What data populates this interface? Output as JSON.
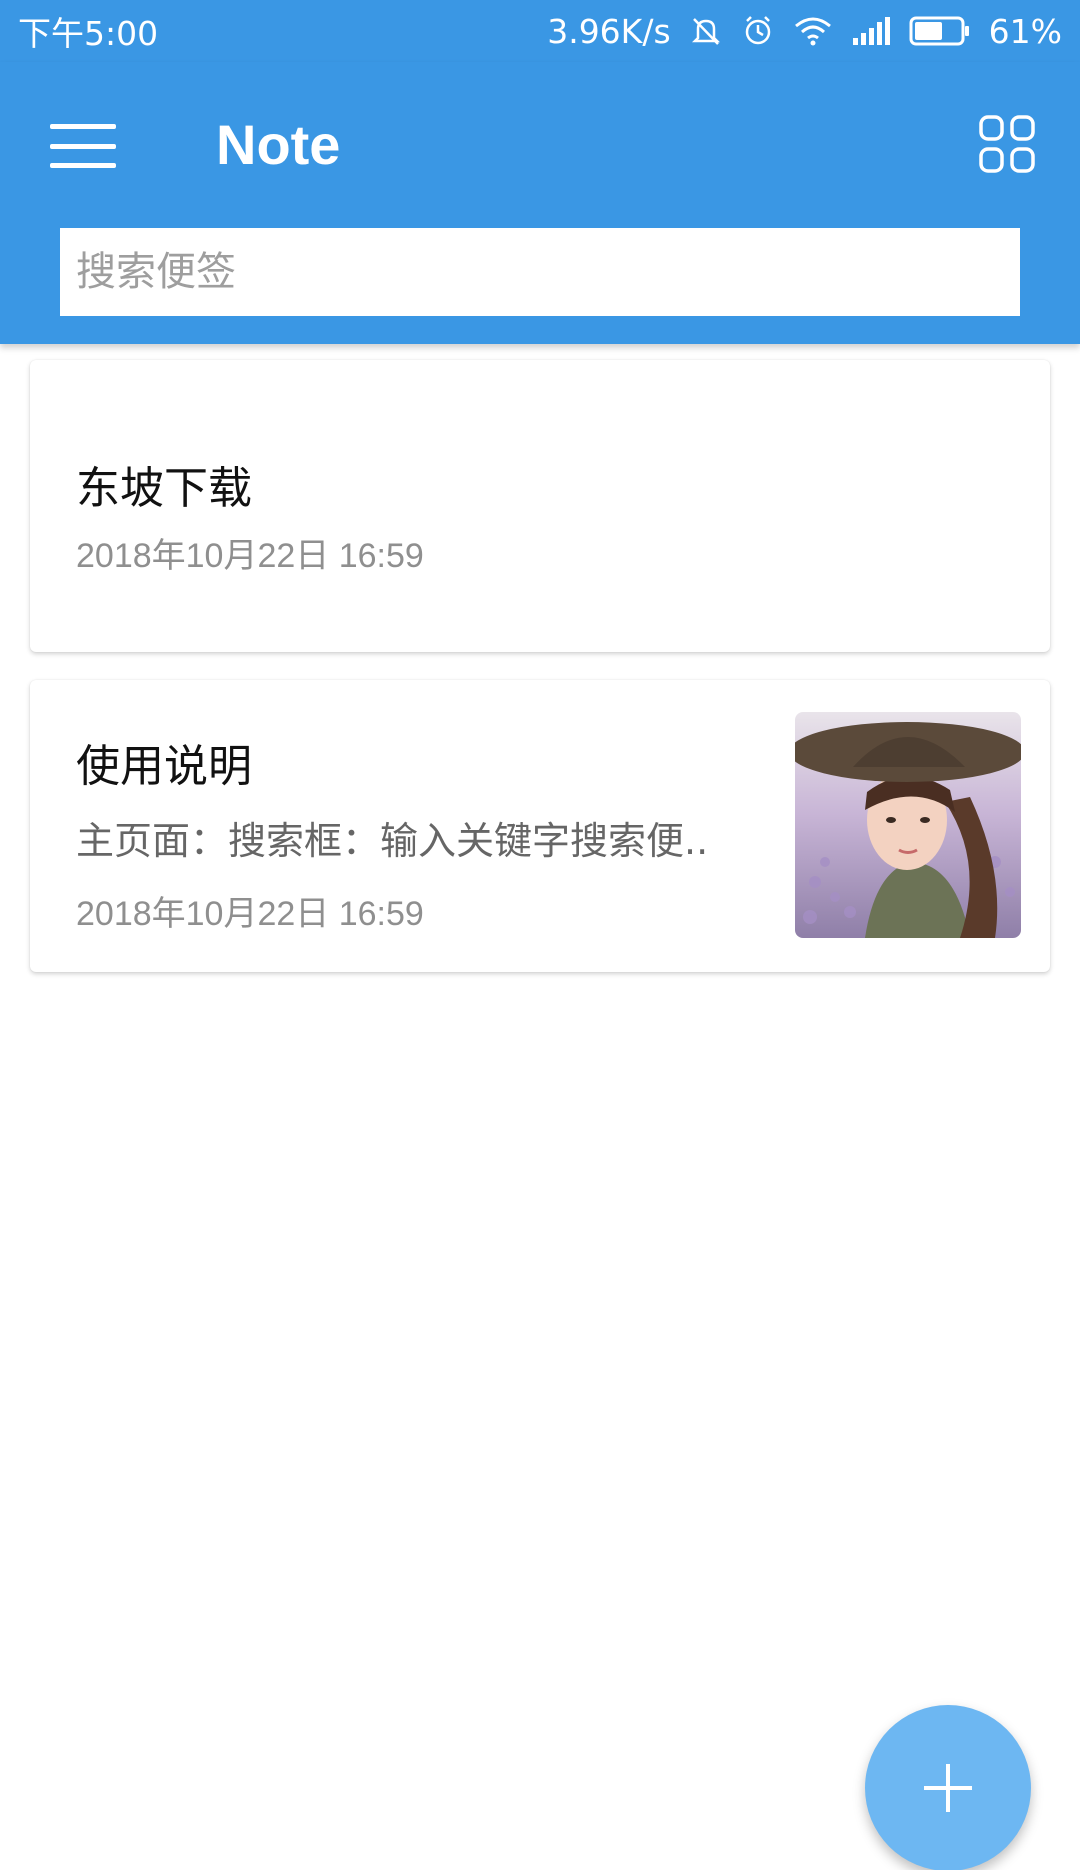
{
  "status_bar": {
    "time": "下午5:00",
    "network_speed": "3.96K/s",
    "battery_percent": "61%",
    "battery_level": 0.61,
    "icons": [
      "bell-off-icon",
      "alarm-icon",
      "wifi-icon",
      "signal-icon",
      "battery-icon"
    ]
  },
  "app_bar": {
    "title": "Note",
    "menu_icon": "hamburger-icon",
    "view_toggle_icon": "grid-view-icon",
    "background": "#3a97e4"
  },
  "search": {
    "placeholder": "搜索便签",
    "value": ""
  },
  "notes": [
    {
      "title": "东坡下载",
      "preview": "",
      "date": "2018年10月22日  16:59",
      "has_image": false
    },
    {
      "title": "使用说明",
      "preview": "主页面：搜索框：输入关键字搜索便..",
      "date": "2018年10月22日  16:59",
      "has_image": true
    }
  ],
  "fab": {
    "icon": "plus-icon",
    "color": "#6db7f2"
  }
}
